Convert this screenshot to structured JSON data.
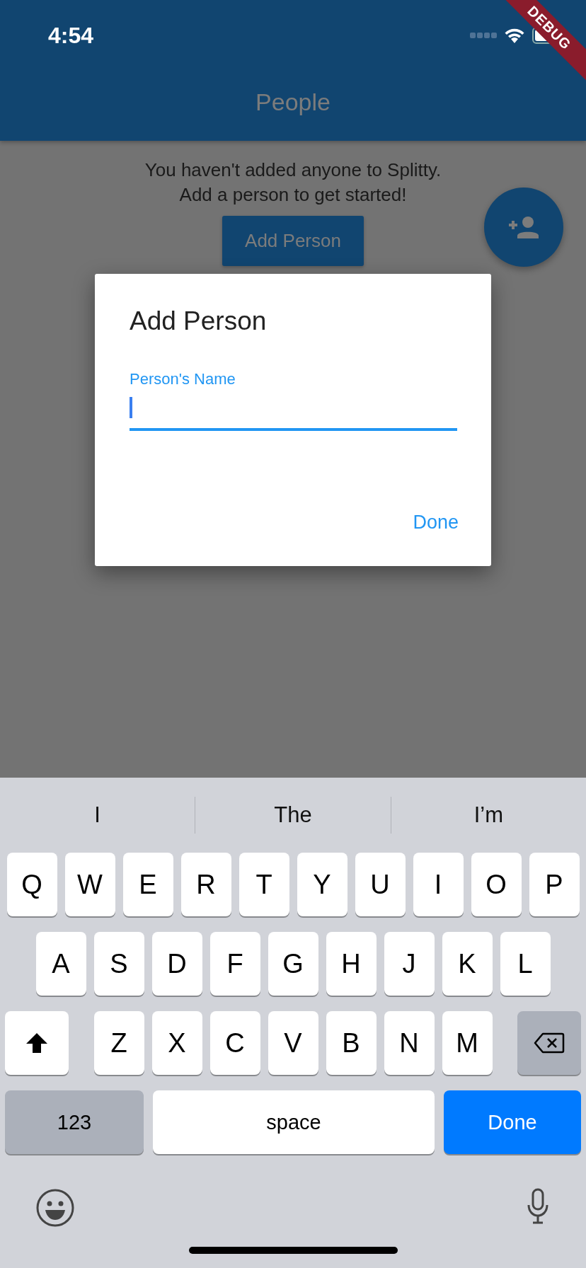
{
  "status_bar": {
    "time": "4:54"
  },
  "debug_banner": "DEBUG",
  "app_bar": {
    "title": "People"
  },
  "empty_state": {
    "message_lines": [
      "You haven't added anyone to Splitty.",
      "Add a person to get started!"
    ],
    "button": "Add Person"
  },
  "dialog": {
    "title": "Add Person",
    "field": {
      "label": "Person's Name",
      "focused": true
    },
    "action": "Done"
  },
  "keyboard": {
    "suggestions": [
      "I",
      "The",
      "I’m"
    ],
    "letter_rows": [
      [
        "Q",
        "W",
        "E",
        "R",
        "T",
        "Y",
        "U",
        "I",
        "O",
        "P"
      ],
      [
        "A",
        "S",
        "D",
        "F",
        "G",
        "H",
        "J",
        "K",
        "L"
      ],
      [
        "Z",
        "X",
        "C",
        "V",
        "B",
        "N",
        "M"
      ]
    ],
    "bottom_keys": [
      {
        "kind": "numbers",
        "label": "123"
      },
      {
        "kind": "space",
        "label": "space"
      },
      {
        "kind": "return",
        "label": "Done"
      }
    ]
  }
}
